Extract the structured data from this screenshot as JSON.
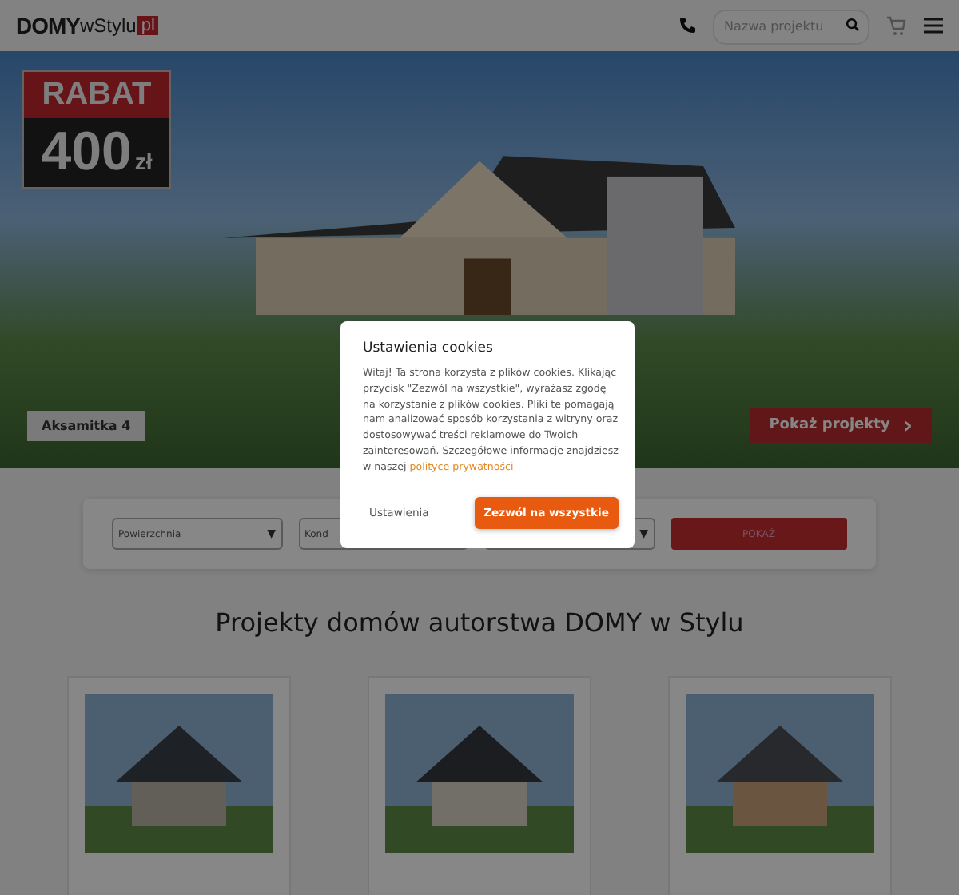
{
  "header": {
    "logo": {
      "brand": "DOMY",
      "suffix": "wStylu",
      "tld": "pl"
    },
    "search": {
      "placeholder": "Nazwa projektu"
    }
  },
  "hero": {
    "promo": {
      "label": "RABAT",
      "amount": "400",
      "unit": "zł"
    },
    "project_name": "Aksamitka 4",
    "cta": "Pokaż projekty",
    "cta_arrow": "›"
  },
  "filters": {
    "selects": [
      {
        "placeholder": "Powierzchnia",
        "arrow": "▼"
      },
      {
        "placeholder": "Kond"
      },
      {
        "arrow": "▼"
      }
    ],
    "submit": "POKAŻ"
  },
  "section_title": "Projekty domów autorstwa DOMY w Stylu",
  "cookie_dialog": {
    "title": "Ustawienia cookies",
    "text": "Witaj! Ta strona korzysta z plików cookies. Klikając przycisk \"Zezwól na wszystkie\", wyrażasz zgodę na korzystanie z plików cookies. Pliki te pomagają nam analizować sposób korzystania z witryny oraz dostosowywać treści reklamowe do Twoich zainteresowań. Szczegółowe informacje znajdziesz w naszej",
    "link": "polityce prywatności",
    "settings": "Ustawienia",
    "accept": "Zezwól na wszystkie"
  }
}
